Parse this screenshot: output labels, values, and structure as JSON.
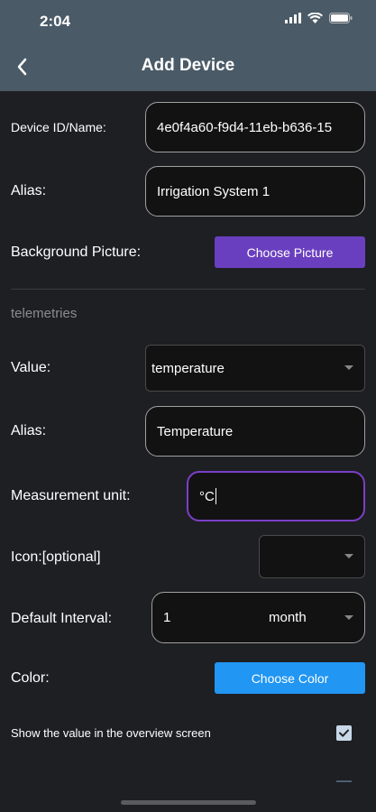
{
  "status": {
    "time": "2:04"
  },
  "nav": {
    "title": "Add Device"
  },
  "form": {
    "device_id_label": "Device ID/Name:",
    "device_id_value": "4e0f4a60-f9d4-11eb-b636-15",
    "alias_label": "Alias:",
    "alias_value": "Irrigation System 1",
    "background_label": "Background Picture:",
    "choose_picture": "Choose Picture",
    "telemetries_title": "telemetries",
    "value_label": "Value:",
    "value_selected": "temperature",
    "tele_alias_label": "Alias:",
    "tele_alias_value": "Temperature",
    "unit_label": "Measurement unit:",
    "unit_value": "°C",
    "icon_label": "Icon:[optional]",
    "interval_label": "Default Interval:",
    "interval_value": "1",
    "interval_unit": "month",
    "color_label": "Color:",
    "choose_color": "Choose Color",
    "show_value_label": "Show the value in the overview screen",
    "show_value_checked": true
  },
  "colors": {
    "header": "#4a5a66",
    "background": "#1e1f23",
    "purple": "#6a3fbf",
    "blue": "#2196f3"
  }
}
